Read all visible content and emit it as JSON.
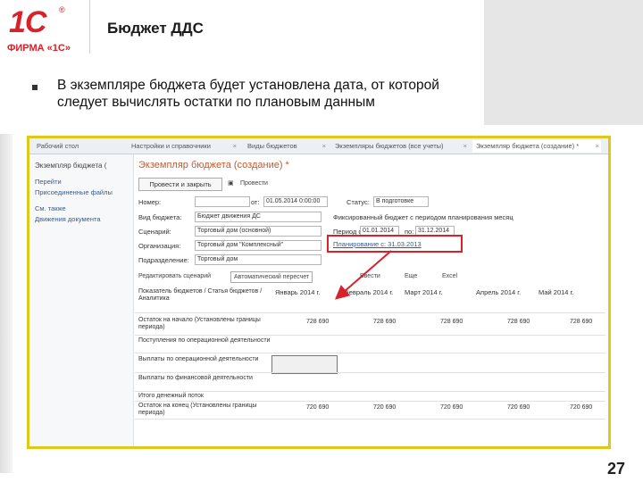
{
  "logo": {
    "main": "1С",
    "reg": "®",
    "sub": "ФИРМА «1С»"
  },
  "slide": {
    "title": "Бюджет ДДС",
    "bullet": "В экземпляре бюджета будет установлена дата, от которой следует вычислять остатки по плановым данным",
    "page_number": "27"
  },
  "app": {
    "tabs": [
      {
        "label": "Рабочий стол"
      },
      {
        "label": "Настройки и справочники"
      },
      {
        "label": "Виды бюджетов"
      },
      {
        "label": "Экземпляры бюджетов (все учеты)"
      },
      {
        "label": "Экземпляр бюджета (создание) *"
      }
    ],
    "sidebar": {
      "title": "Экземпляр бюджета (",
      "links": [
        "Перейти",
        "Присоединенные файлы",
        "См. также",
        "Движения документа"
      ]
    },
    "form": {
      "title": "Экземпляр бюджета (создание) *",
      "post_close": "Провести и закрыть",
      "post": "Провести",
      "number_label": "Номер:",
      "number_value": "",
      "date_prefix": "от:",
      "date_value": "01.05.2014 0:00:00",
      "status_label": "Статус:",
      "status_value": "В подготовке",
      "budget_type_label": "Вид бюджета:",
      "budget_type_value": "Бюджет движения ДС",
      "budget_desc": "Фиксированный бюджет с периодом планирования месяц",
      "scenario_label": "Сценарий:",
      "scenario_value": "Торговый дом (основной)",
      "period_label": "Период с:",
      "period_from": "01.01.2014",
      "period_to_label": "по:",
      "period_to": "31.12.2014",
      "org_label": "Организация:",
      "org_value": "Торговый дом \"Комплексный\"",
      "plan_fact_link": "Планирование с: 31.03.2013",
      "division_label": "Подразделение:",
      "division_value": "Торговый дом",
      "edit_btn": "Редактировать сценарий",
      "auto_btn": "Автоматический пересчет",
      "arrange_btn": "Ввести",
      "more_btn": "Excel",
      "all_actions": "Еще"
    },
    "table": {
      "header_col": "Показатель бюджетов / Статья бюджетов / Аналитика",
      "months": [
        "Январь 2014 г.",
        "Февраль 2014 г.",
        "Март 2014 г.",
        "Апрель 2014 г.",
        "Май 2014 г."
      ],
      "rows": [
        {
          "label": "Остаток на начало (Установлены границы периода)",
          "values": [
            "728 690",
            "728 690",
            "728 690",
            "728 690",
            "728 690"
          ]
        },
        {
          "label": "Поступления по операционной деятельности",
          "values": [
            "",
            "",
            "",
            "",
            ""
          ]
        },
        {
          "label": "Выплаты по операционной деятельности",
          "values": [
            "",
            "",
            "",
            "",
            ""
          ]
        },
        {
          "label": "Выплаты по финансовой деятельности",
          "values": [
            "",
            "",
            "",
            "",
            ""
          ]
        },
        {
          "label": "Итого денежный поток",
          "values": [
            "",
            "",
            "",
            "",
            ""
          ]
        },
        {
          "label": "Остаток на конец (Установлены границы периода)",
          "values": [
            "720 690",
            "720 690",
            "720 690",
            "720 690",
            "720 690"
          ]
        }
      ]
    }
  },
  "colors": {
    "brand_red": "#d8222a",
    "highlight_yellow": "#e0c81a",
    "form_title_orange": "#c75a2a"
  }
}
